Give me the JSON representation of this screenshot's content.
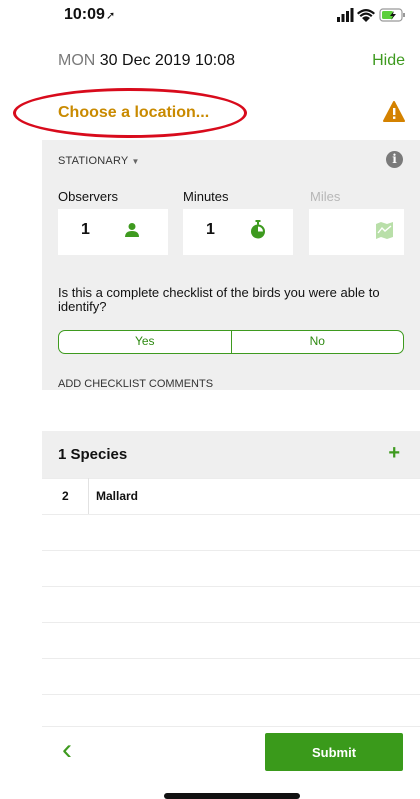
{
  "status_bar": {
    "time": "10:09",
    "arrow": "➚"
  },
  "header": {
    "day": "MON",
    "datetime": "30 Dec 2019 10:08",
    "hide_label": "Hide"
  },
  "location": {
    "placeholder": "Choose a location...",
    "warning_icon": "warning-triangle",
    "accent": "#c98a00"
  },
  "protocol": {
    "label": "STATIONARY",
    "caret": "▼"
  },
  "fields": {
    "observers": {
      "label": "Observers",
      "value": "1",
      "icon": "person-icon"
    },
    "minutes": {
      "label": "Minutes",
      "value": "1",
      "icon": "stopwatch-icon"
    },
    "miles": {
      "label": "Miles",
      "value": "",
      "icon": "map-icon"
    }
  },
  "complete_question": "Is this a complete checklist of the birds you were able to identify?",
  "complete_options": {
    "yes": "Yes",
    "no": "No"
  },
  "comments_label": "ADD CHECKLIST COMMENTS",
  "species": {
    "title": "1 Species",
    "add": "+",
    "rows": [
      {
        "count": "2",
        "name": "Mallard"
      }
    ]
  },
  "footer": {
    "back": "‹",
    "submit_label": "Submit"
  },
  "colors": {
    "brand_green": "#3a9a1b",
    "annotation_red": "#d80b1c"
  }
}
